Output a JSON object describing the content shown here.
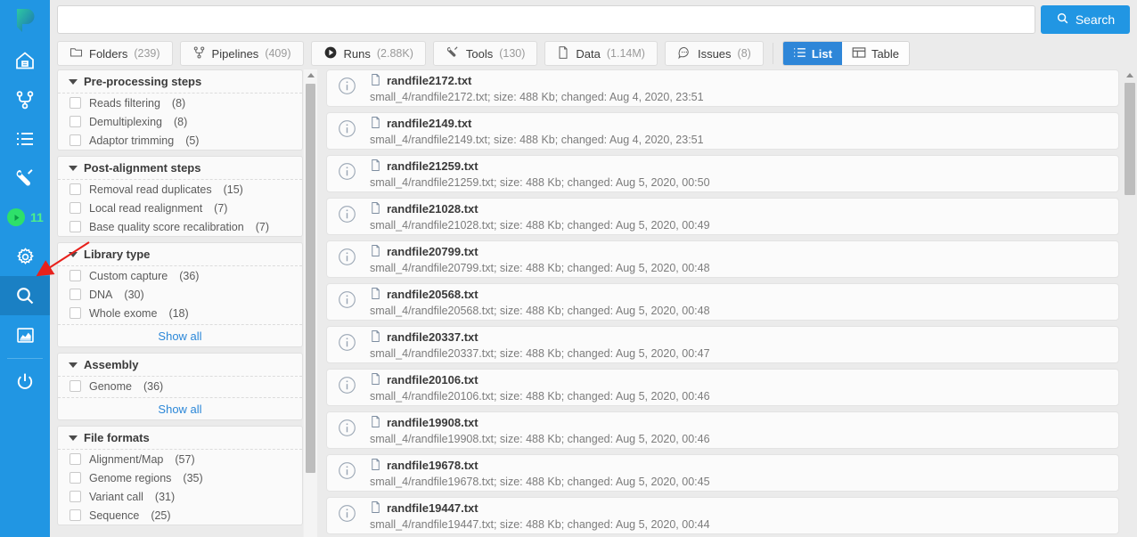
{
  "brand": {
    "logo_letter": "P",
    "accent": "#2196e3",
    "rail_bg": "#2196e3",
    "active_bg": "#1a80c4"
  },
  "rail": {
    "items": [
      {
        "name": "home-icon",
        "label": "Home"
      },
      {
        "name": "pipelines-icon",
        "label": "Pipelines"
      },
      {
        "name": "list-icon",
        "label": "Projects"
      },
      {
        "name": "wrench-icon",
        "label": "Tools"
      }
    ],
    "running_badge": {
      "count": "11",
      "icon": "play-icon",
      "color": "#2ee06a",
      "text_color": "#4ef08a"
    },
    "lower_items": [
      {
        "name": "gear-icon",
        "label": "Settings"
      },
      {
        "name": "search-icon",
        "label": "Search",
        "active": true
      },
      {
        "name": "chart-icon",
        "label": "Reports"
      }
    ],
    "power": {
      "name": "power-icon",
      "label": "Log out"
    }
  },
  "search": {
    "value": "",
    "placeholder": "",
    "button_label": "Search",
    "button_icon": "search-icon"
  },
  "tabs": [
    {
      "id": "folders",
      "icon": "folder-icon",
      "label": "Folders",
      "count": "(239)"
    },
    {
      "id": "pipelines",
      "icon": "pipeline-icon",
      "label": "Pipelines",
      "count": "(409)"
    },
    {
      "id": "runs",
      "icon": "play-icon",
      "label": "Runs",
      "count": "(2.88K)"
    },
    {
      "id": "tools",
      "icon": "wrench-icon",
      "label": "Tools",
      "count": "(130)"
    },
    {
      "id": "data",
      "icon": "file-icon",
      "label": "Data",
      "count": "(1.14M)"
    },
    {
      "id": "issues",
      "icon": "comment-icon",
      "label": "Issues",
      "count": "(8)"
    }
  ],
  "view_toggle": {
    "active": "list",
    "options": [
      {
        "id": "list",
        "label": "List",
        "icon": "list-view-icon"
      },
      {
        "id": "table",
        "label": "Table",
        "icon": "table-view-icon"
      }
    ]
  },
  "facets": [
    {
      "title": "Pre-processing steps",
      "expanded": true,
      "options": [
        {
          "label": "Reads filtering",
          "count": "(8)",
          "checked": false
        },
        {
          "label": "Demultiplexing",
          "count": "(8)",
          "checked": false
        },
        {
          "label": "Adaptor trimming",
          "count": "(5)",
          "checked": false
        }
      ],
      "show_all": null
    },
    {
      "title": "Post-alignment steps",
      "expanded": true,
      "options": [
        {
          "label": "Removal read duplicates",
          "count": "(15)",
          "checked": false
        },
        {
          "label": "Local read realignment",
          "count": "(7)",
          "checked": false
        },
        {
          "label": "Base quality score recalibration",
          "count": "(7)",
          "checked": false
        }
      ],
      "show_all": null
    },
    {
      "title": "Library type",
      "expanded": true,
      "options": [
        {
          "label": "Custom capture",
          "count": "(36)",
          "checked": false
        },
        {
          "label": "DNA",
          "count": "(30)",
          "checked": false
        },
        {
          "label": "Whole exome",
          "count": "(18)",
          "checked": false
        }
      ],
      "show_all": "Show all"
    },
    {
      "title": "Assembly",
      "expanded": true,
      "options": [
        {
          "label": "Genome",
          "count": "(36)",
          "checked": false
        }
      ],
      "show_all": "Show all"
    },
    {
      "title": "File formats",
      "expanded": true,
      "options": [
        {
          "label": "Alignment/Map",
          "count": "(57)",
          "checked": false
        },
        {
          "label": "Genome regions",
          "count": "(35)",
          "checked": false
        },
        {
          "label": "Variant call",
          "count": "(31)",
          "checked": false
        },
        {
          "label": "Sequence",
          "count": "(25)",
          "checked": false
        }
      ],
      "show_all": null
    }
  ],
  "results": [
    {
      "name": "randfile2172.txt",
      "meta": "small_4/randfile2172.txt;  size: 488 Kb;  changed: Aug 4, 2020, 23:51"
    },
    {
      "name": "randfile2149.txt",
      "meta": "small_4/randfile2149.txt;  size: 488 Kb;  changed: Aug 4, 2020, 23:51"
    },
    {
      "name": "randfile21259.txt",
      "meta": "small_4/randfile21259.txt;  size: 488 Kb;  changed: Aug 5, 2020, 00:50"
    },
    {
      "name": "randfile21028.txt",
      "meta": "small_4/randfile21028.txt;  size: 488 Kb;  changed: Aug 5, 2020, 00:49"
    },
    {
      "name": "randfile20799.txt",
      "meta": "small_4/randfile20799.txt;  size: 488 Kb;  changed: Aug 5, 2020, 00:48"
    },
    {
      "name": "randfile20568.txt",
      "meta": "small_4/randfile20568.txt;  size: 488 Kb;  changed: Aug 5, 2020, 00:48"
    },
    {
      "name": "randfile20337.txt",
      "meta": "small_4/randfile20337.txt;  size: 488 Kb;  changed: Aug 5, 2020, 00:47"
    },
    {
      "name": "randfile20106.txt",
      "meta": "small_4/randfile20106.txt;  size: 488 Kb;  changed: Aug 5, 2020, 00:46"
    },
    {
      "name": "randfile19908.txt",
      "meta": "small_4/randfile19908.txt;  size: 488 Kb;  changed: Aug 5, 2020, 00:46"
    },
    {
      "name": "randfile19678.txt",
      "meta": "small_4/randfile19678.txt;  size: 488 Kb;  changed: Aug 5, 2020, 00:45"
    },
    {
      "name": "randfile19447.txt",
      "meta": "small_4/randfile19447.txt;  size: 488 Kb;  changed: Aug 5, 2020, 00:44"
    }
  ],
  "annotation": {
    "arrow_color": "#e8211c",
    "points_to": "search-icon"
  }
}
